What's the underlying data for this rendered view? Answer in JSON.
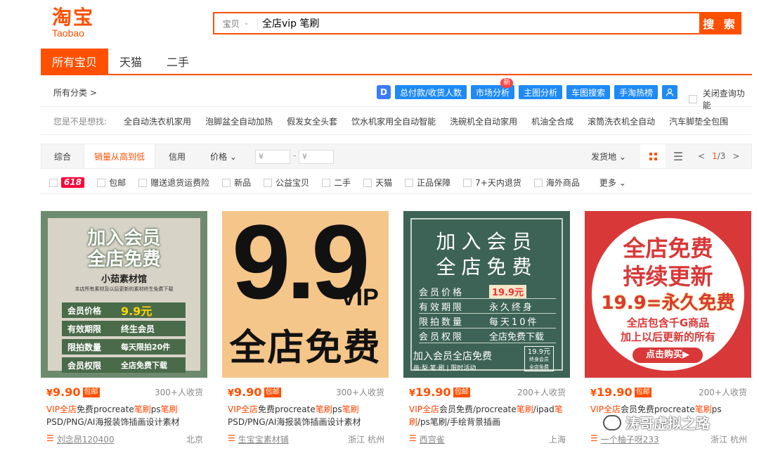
{
  "logo": {
    "cn": "淘宝",
    "en": "Taobao"
  },
  "search": {
    "type_label": "宝贝",
    "query": "全店vip 笔刷",
    "button": "搜 索"
  },
  "tabs": [
    "所有宝贝",
    "天猫",
    "二手"
  ],
  "category": {
    "all_label": "所有分类 >"
  },
  "tools": {
    "logo_letter": "D",
    "buttons": [
      "总付款/收货人数",
      "市场分析",
      "主图分析",
      "车图搜索",
      "手淘热榜"
    ],
    "new_badge": "新",
    "user_icon": "person-icon",
    "close_label": "关闭查询功能"
  },
  "suggestions": {
    "label": "您是不是想找:",
    "items": [
      "全自动洗衣机家用",
      "泡脚盆全自动加热",
      "假发女全头套",
      "饮水机家用全自动智能",
      "洗碗机全自动家用",
      "机油全合成",
      "滚筒洗衣机全自动",
      "汽车脚垫全包围"
    ]
  },
  "sort": {
    "items": [
      "综合",
      "销量从高到低",
      "信用",
      "价格 ⌄"
    ],
    "price_from": "¥",
    "price_to": "¥",
    "dash": "-",
    "ship_from": "发货地 ⌄",
    "pager_prev": "<",
    "pager_cur": "1",
    "pager_total": "/3",
    "pager_next": ">"
  },
  "filters": [
    "618",
    "包邮",
    "赠送退货运费险",
    "新品",
    "公益宝贝",
    "二手",
    "天猫",
    "正品保障",
    "7+天内退货",
    "海外商品"
  ],
  "more": "更多 ⌄",
  "products": [
    {
      "price": "9.90",
      "tag": "包邮",
      "sales": "300+人收货",
      "title_hl1": "VIP全店",
      "title_mid": "免费procreate",
      "title_hl2": "笔刷",
      "title_mid2": "ps",
      "title_hl3": "笔刷",
      "title_rest": "PSD/PNG/AI海报装饰插画设计素材",
      "shop": "刘念昂120400",
      "loc": "北京",
      "image": {
        "line1": "加入会员",
        "line2": "全店免费",
        "brand": "小茹素材馆",
        "desc": "本店所有素材及以后更新的素材终生免费下载",
        "rows": [
          [
            "会员价格",
            "9.9元"
          ],
          [
            "有效期限",
            "终生会员"
          ],
          [
            "限拍数量",
            "每天限拍20件"
          ],
          [
            "会员权限",
            "全店免费下载"
          ]
        ]
      }
    },
    {
      "price": "9.90",
      "tag": "包邮",
      "sales": "300+人收货",
      "title_hl1": "VIP全店",
      "title_mid": "免费procreate",
      "title_hl2": "笔刷",
      "title_mid2": "ps",
      "title_hl3": "笔刷",
      "title_rest": "PSD/PNG/AI海报装饰插画设计素材",
      "shop": "生宝宝素材铺",
      "loc": "浙江 杭州",
      "image": {
        "big": "9.9",
        "vip": "VIP",
        "line": "全店免费"
      }
    },
    {
      "price": "19.90",
      "tag": "包邮",
      "sales": "200+人收货",
      "title_hl1": "VIP全店",
      "title_mid": "会员免费/procreate",
      "title_hl2": "笔刷",
      "title_mid2": "/ipad",
      "title_hl3": "笔",
      "title_rest_hl": "刷",
      "title_rest": "/ps笔刷/手绘背景插画",
      "shop": "西宫雀",
      "loc": "上海",
      "image": {
        "line1": "加入会员",
        "line2": "全店免费",
        "rows": [
          [
            "会员价格",
            "19.9元"
          ],
          [
            "有效期限",
            "永久终身"
          ],
          [
            "限拍数量",
            "每天10件"
          ],
          [
            "会员权限",
            "全店免费下载"
          ]
        ],
        "bottom": "加入会员全店免费",
        "bottom_sub": "画·梨·笔·刷 | 限时活动",
        "badge": "19.9元",
        "badge_sub": "终身会员",
        "badge_sub2": "全店免费"
      }
    },
    {
      "price": "19.90",
      "tag": "包邮",
      "sales": "200+人收货",
      "title_hl1": "VIP全店",
      "title_mid": "会员免费procreate",
      "title_hl2": "笔刷",
      "title_mid2": "ps",
      "title_hl3": "",
      "title_rest": "",
      "shop": "一个柚子呀233",
      "loc": "浙江 杭州",
      "image": {
        "line1": "全店免费",
        "line2": "持续更新",
        "line3": "19.9=永久免费",
        "line4": "全店包含千G商品",
        "line5": "加上以后更新的所有",
        "btn": "点击购买▶"
      }
    }
  ],
  "watermark": "涛哥虚拟之路"
}
